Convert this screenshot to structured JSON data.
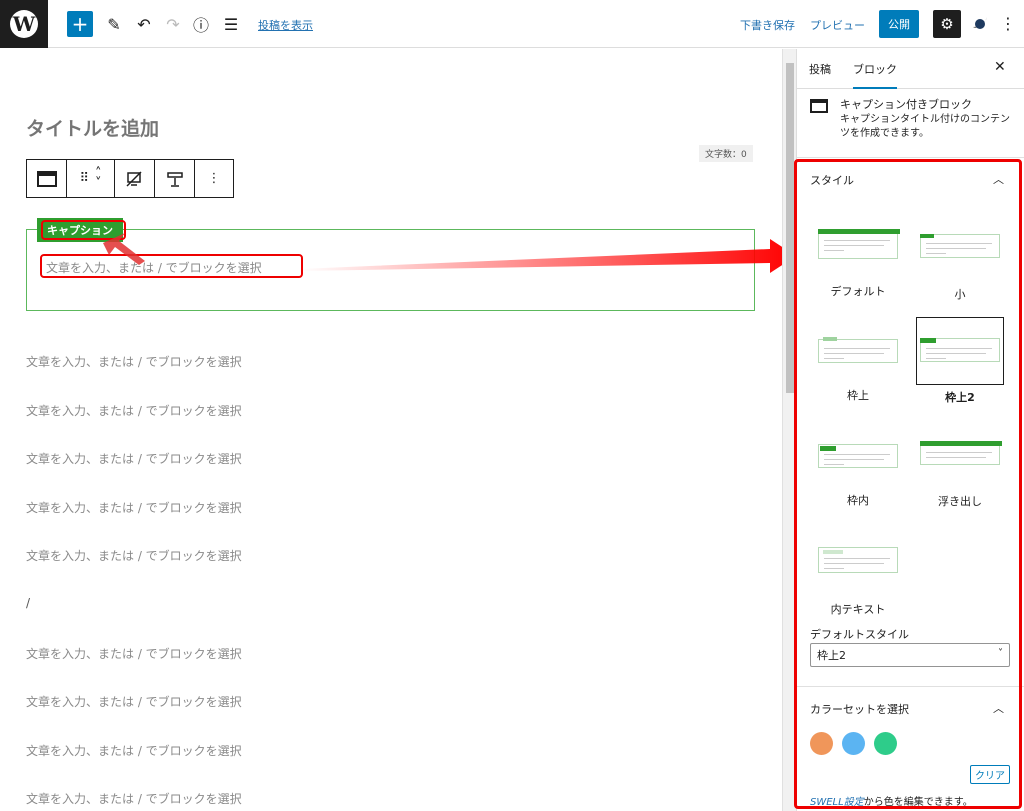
{
  "topbar": {
    "wp_logo": "W",
    "add_icon": "+",
    "tools_icon": "✎",
    "undo_icon": "↶",
    "redo_icon": "↷",
    "info_icon": "ⓘ",
    "list_view_icon": "☰",
    "view_post_link": "投稿を表示",
    "save_draft": "下書き保存",
    "preview": "プレビュー",
    "publish": "公開",
    "settings_icon": "⚙",
    "more_icon": "⋮",
    "accent_color": "#007cba"
  },
  "editor": {
    "title_placeholder": "タイトルを追加",
    "char_count": "文字数：0",
    "toolbar": {
      "drag_icon": "⠿",
      "up_icon": "˄",
      "down_icon": "˅",
      "more_icon": "⋮"
    },
    "caption_block": {
      "label": "キャプション",
      "placeholder": "文章を入力、または / でブロックを選択",
      "color": "#2f9e2f"
    },
    "paragraphs": [
      "文章を入力、または / でブロックを選択",
      "文章を入力、または / でブロックを選択",
      "文章を入力、または / でブロックを選択",
      "文章を入力、または / でブロックを選択",
      "文章を入力、または / でブロックを選択",
      "/",
      "文章を入力、または / でブロックを選択",
      "文章を入力、または / でブロックを選択",
      "文章を入力、または / でブロックを選択",
      "文章を入力、または / でブロックを選択"
    ]
  },
  "sidebar": {
    "tab_post": "投稿",
    "tab_block": "ブロック",
    "close_icon": "✕",
    "block_title": "キャプション付きブロック",
    "block_description": "キャプションタイトル付けのコンテンツを作成できます。",
    "styles_section": {
      "title": "スタイル",
      "options": [
        {
          "label": "デフォルト"
        },
        {
          "label": "小"
        },
        {
          "label": "枠上"
        },
        {
          "label": "枠上2"
        },
        {
          "label": "枠内"
        },
        {
          "label": "浮き出し"
        },
        {
          "label": "内テキスト"
        }
      ],
      "selected": "枠上2",
      "default_style_label": "デフォルトスタイル",
      "default_style_value": "枠上2"
    },
    "color_section": {
      "title": "カラーセットを選択",
      "swatches": [
        "#f0965a",
        "#5bb4f2",
        "#2ecc8a"
      ],
      "clear": "クリア",
      "note_link": "SWELL設定",
      "note_text": "から色を編集できます。"
    }
  },
  "annotation_color": "#ee0000"
}
